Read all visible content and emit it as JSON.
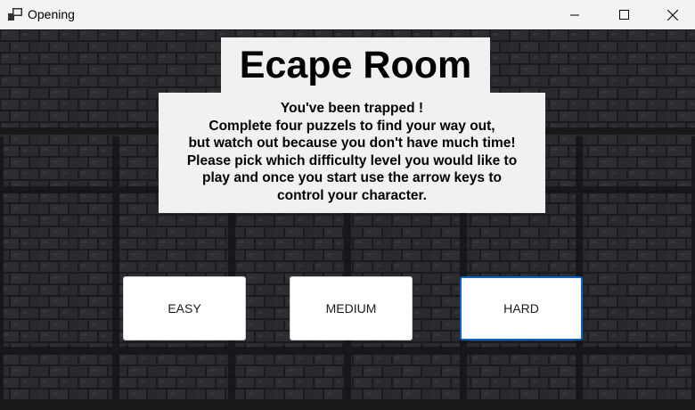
{
  "window": {
    "title": "Opening"
  },
  "game": {
    "title": "Ecape Room",
    "description_lines": [
      "You've been trapped !",
      "Complete four puzzels to find your way out,",
      "but watch out because you don't have much time!",
      "Please pick which difficulty level you would like to",
      "play and once you start use the arrow keys to",
      "control your character."
    ]
  },
  "buttons": {
    "easy": "EASY",
    "medium": "MEDIUM",
    "hard": "HARD"
  },
  "colors": {
    "wall_dark": "#1a1a1e",
    "wall_stone": "#2a2a2f",
    "panel_bg": "#f1f1f1",
    "focus_border": "#0a64c8"
  }
}
